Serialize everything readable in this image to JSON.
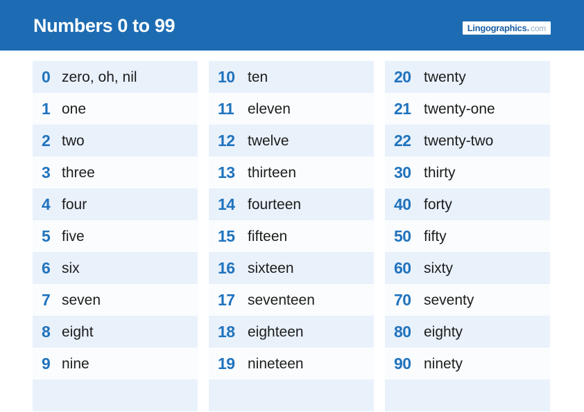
{
  "header": {
    "title": "Numbers 0 to 99",
    "logo": {
      "name": "Lingographics",
      "tld": ".com"
    },
    "background_color": "#1d6cb3",
    "title_color": "#ffffff"
  },
  "theme": {
    "accent_blue": "#1f73bd",
    "row_stripe": "#e9f1fb",
    "row_base": "#fafcfe",
    "word_color": "#1c1c1c"
  },
  "columns": [
    {
      "name": "column-ones",
      "rows": [
        {
          "number": "0",
          "word": "zero, oh, nil"
        },
        {
          "number": "1",
          "word": "one"
        },
        {
          "number": "2",
          "word": "two"
        },
        {
          "number": "3",
          "word": "three"
        },
        {
          "number": "4",
          "word": "four"
        },
        {
          "number": "5",
          "word": "five"
        },
        {
          "number": "6",
          "word": "six"
        },
        {
          "number": "7",
          "word": "seven"
        },
        {
          "number": "8",
          "word": "eight"
        },
        {
          "number": "9",
          "word": "nine"
        },
        {
          "number": "",
          "word": ""
        }
      ]
    },
    {
      "name": "column-teens",
      "rows": [
        {
          "number": "10",
          "word": "ten"
        },
        {
          "number": "11",
          "word": "eleven"
        },
        {
          "number": "12",
          "word": "twelve"
        },
        {
          "number": "13",
          "word": "thirteen"
        },
        {
          "number": "14",
          "word": "fourteen"
        },
        {
          "number": "15",
          "word": "fifteen"
        },
        {
          "number": "16",
          "word": "sixteen"
        },
        {
          "number": "17",
          "word": "seventeen"
        },
        {
          "number": "18",
          "word": "eighteen"
        },
        {
          "number": "19",
          "word": "nineteen"
        },
        {
          "number": "",
          "word": ""
        }
      ]
    },
    {
      "name": "column-tens",
      "rows": [
        {
          "number": "20",
          "word": "twenty"
        },
        {
          "number": "21",
          "word": "twenty-one"
        },
        {
          "number": "22",
          "word": "twenty-two"
        },
        {
          "number": "30",
          "word": "thirty"
        },
        {
          "number": "40",
          "word": "forty"
        },
        {
          "number": "50",
          "word": "fifty"
        },
        {
          "number": "60",
          "word": "sixty"
        },
        {
          "number": "70",
          "word": "seventy"
        },
        {
          "number": "80",
          "word": "eighty"
        },
        {
          "number": "90",
          "word": "ninety"
        },
        {
          "number": "",
          "word": ""
        }
      ]
    }
  ]
}
